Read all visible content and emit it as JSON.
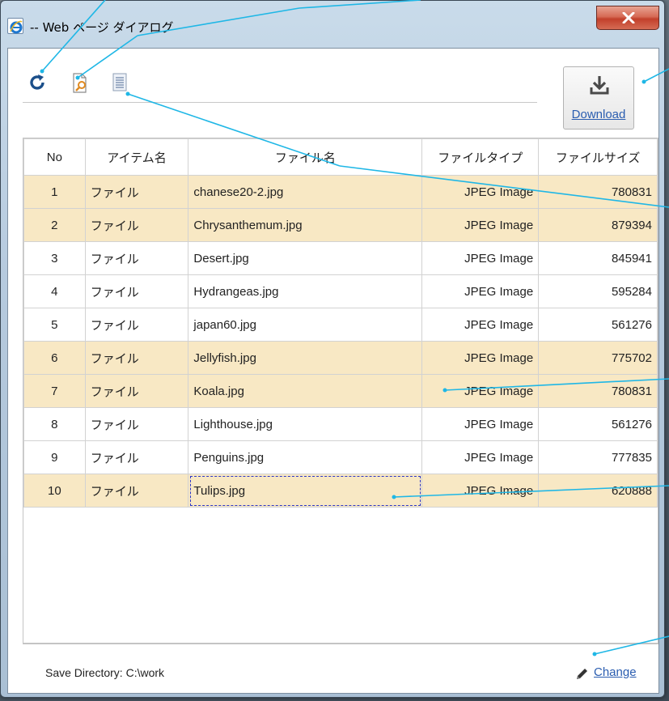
{
  "window": {
    "title": "-- Web ページ ダイアログ",
    "close_glyph": "X"
  },
  "toolbar": {
    "icons": [
      "refresh-icon",
      "preview-icon",
      "list-icon"
    ],
    "download_label": "Download"
  },
  "table": {
    "headers": [
      "No",
      "アイテム名",
      "ファイル名",
      "ファイルタイプ",
      "ファイルサイズ"
    ],
    "rows": [
      {
        "no": "1",
        "item": "ファイル",
        "file": "chanese20-2.jpg",
        "type": "JPEG Image",
        "size": "780831",
        "highlighted": true
      },
      {
        "no": "2",
        "item": "ファイル",
        "file": "Chrysanthemum.jpg",
        "type": "JPEG Image",
        "size": "879394",
        "highlighted": true
      },
      {
        "no": "3",
        "item": "ファイル",
        "file": "Desert.jpg",
        "type": "JPEG Image",
        "size": "845941",
        "highlighted": false
      },
      {
        "no": "4",
        "item": "ファイル",
        "file": "Hydrangeas.jpg",
        "type": "JPEG Image",
        "size": "595284",
        "highlighted": false
      },
      {
        "no": "5",
        "item": "ファイル",
        "file": "japan60.jpg",
        "type": "JPEG Image",
        "size": "561276",
        "highlighted": false
      },
      {
        "no": "6",
        "item": "ファイル",
        "file": "Jellyfish.jpg",
        "type": "JPEG Image",
        "size": "775702",
        "highlighted": true
      },
      {
        "no": "7",
        "item": "ファイル",
        "file": "Koala.jpg",
        "type": "JPEG Image",
        "size": "780831",
        "highlighted": true
      },
      {
        "no": "8",
        "item": "ファイル",
        "file": "Lighthouse.jpg",
        "type": "JPEG Image",
        "size": "561276",
        "highlighted": false
      },
      {
        "no": "9",
        "item": "ファイル",
        "file": "Penguins.jpg",
        "type": "JPEG Image",
        "size": "777835",
        "highlighted": false
      },
      {
        "no": "10",
        "item": "ファイル",
        "file": "Tulips.jpg",
        "type": "JPEG Image",
        "size": "620888",
        "highlighted": true
      }
    ]
  },
  "footer": {
    "save_directory": "Save Directory: C:\\work",
    "change_label": "Change"
  },
  "colors": {
    "highlight_row": "#f8e8c4",
    "link": "#2a5db0",
    "callout_line": "#1fb7e6"
  }
}
